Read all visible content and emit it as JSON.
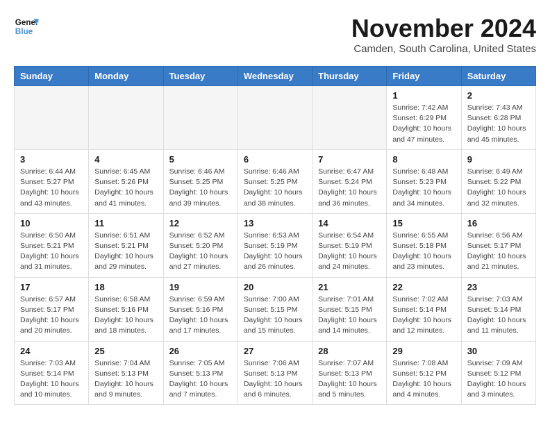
{
  "header": {
    "logo_line1": "General",
    "logo_line2": "Blue",
    "month_title": "November 2024",
    "location": "Camden, South Carolina, United States"
  },
  "weekdays": [
    "Sunday",
    "Monday",
    "Tuesday",
    "Wednesday",
    "Thursday",
    "Friday",
    "Saturday"
  ],
  "weeks": [
    [
      {
        "day": "",
        "info": ""
      },
      {
        "day": "",
        "info": ""
      },
      {
        "day": "",
        "info": ""
      },
      {
        "day": "",
        "info": ""
      },
      {
        "day": "",
        "info": ""
      },
      {
        "day": "1",
        "info": "Sunrise: 7:42 AM\nSunset: 6:29 PM\nDaylight: 10 hours\nand 47 minutes."
      },
      {
        "day": "2",
        "info": "Sunrise: 7:43 AM\nSunset: 6:28 PM\nDaylight: 10 hours\nand 45 minutes."
      }
    ],
    [
      {
        "day": "3",
        "info": "Sunrise: 6:44 AM\nSunset: 5:27 PM\nDaylight: 10 hours\nand 43 minutes."
      },
      {
        "day": "4",
        "info": "Sunrise: 6:45 AM\nSunset: 5:26 PM\nDaylight: 10 hours\nand 41 minutes."
      },
      {
        "day": "5",
        "info": "Sunrise: 6:46 AM\nSunset: 5:25 PM\nDaylight: 10 hours\nand 39 minutes."
      },
      {
        "day": "6",
        "info": "Sunrise: 6:46 AM\nSunset: 5:25 PM\nDaylight: 10 hours\nand 38 minutes."
      },
      {
        "day": "7",
        "info": "Sunrise: 6:47 AM\nSunset: 5:24 PM\nDaylight: 10 hours\nand 36 minutes."
      },
      {
        "day": "8",
        "info": "Sunrise: 6:48 AM\nSunset: 5:23 PM\nDaylight: 10 hours\nand 34 minutes."
      },
      {
        "day": "9",
        "info": "Sunrise: 6:49 AM\nSunset: 5:22 PM\nDaylight: 10 hours\nand 32 minutes."
      }
    ],
    [
      {
        "day": "10",
        "info": "Sunrise: 6:50 AM\nSunset: 5:21 PM\nDaylight: 10 hours\nand 31 minutes."
      },
      {
        "day": "11",
        "info": "Sunrise: 6:51 AM\nSunset: 5:21 PM\nDaylight: 10 hours\nand 29 minutes."
      },
      {
        "day": "12",
        "info": "Sunrise: 6:52 AM\nSunset: 5:20 PM\nDaylight: 10 hours\nand 27 minutes."
      },
      {
        "day": "13",
        "info": "Sunrise: 6:53 AM\nSunset: 5:19 PM\nDaylight: 10 hours\nand 26 minutes."
      },
      {
        "day": "14",
        "info": "Sunrise: 6:54 AM\nSunset: 5:19 PM\nDaylight: 10 hours\nand 24 minutes."
      },
      {
        "day": "15",
        "info": "Sunrise: 6:55 AM\nSunset: 5:18 PM\nDaylight: 10 hours\nand 23 minutes."
      },
      {
        "day": "16",
        "info": "Sunrise: 6:56 AM\nSunset: 5:17 PM\nDaylight: 10 hours\nand 21 minutes."
      }
    ],
    [
      {
        "day": "17",
        "info": "Sunrise: 6:57 AM\nSunset: 5:17 PM\nDaylight: 10 hours\nand 20 minutes."
      },
      {
        "day": "18",
        "info": "Sunrise: 6:58 AM\nSunset: 5:16 PM\nDaylight: 10 hours\nand 18 minutes."
      },
      {
        "day": "19",
        "info": "Sunrise: 6:59 AM\nSunset: 5:16 PM\nDaylight: 10 hours\nand 17 minutes."
      },
      {
        "day": "20",
        "info": "Sunrise: 7:00 AM\nSunset: 5:15 PM\nDaylight: 10 hours\nand 15 minutes."
      },
      {
        "day": "21",
        "info": "Sunrise: 7:01 AM\nSunset: 5:15 PM\nDaylight: 10 hours\nand 14 minutes."
      },
      {
        "day": "22",
        "info": "Sunrise: 7:02 AM\nSunset: 5:14 PM\nDaylight: 10 hours\nand 12 minutes."
      },
      {
        "day": "23",
        "info": "Sunrise: 7:03 AM\nSunset: 5:14 PM\nDaylight: 10 hours\nand 11 minutes."
      }
    ],
    [
      {
        "day": "24",
        "info": "Sunrise: 7:03 AM\nSunset: 5:14 PM\nDaylight: 10 hours\nand 10 minutes."
      },
      {
        "day": "25",
        "info": "Sunrise: 7:04 AM\nSunset: 5:13 PM\nDaylight: 10 hours\nand 9 minutes."
      },
      {
        "day": "26",
        "info": "Sunrise: 7:05 AM\nSunset: 5:13 PM\nDaylight: 10 hours\nand 7 minutes."
      },
      {
        "day": "27",
        "info": "Sunrise: 7:06 AM\nSunset: 5:13 PM\nDaylight: 10 hours\nand 6 minutes."
      },
      {
        "day": "28",
        "info": "Sunrise: 7:07 AM\nSunset: 5:13 PM\nDaylight: 10 hours\nand 5 minutes."
      },
      {
        "day": "29",
        "info": "Sunrise: 7:08 AM\nSunset: 5:12 PM\nDaylight: 10 hours\nand 4 minutes."
      },
      {
        "day": "30",
        "info": "Sunrise: 7:09 AM\nSunset: 5:12 PM\nDaylight: 10 hours\nand 3 minutes."
      }
    ]
  ]
}
